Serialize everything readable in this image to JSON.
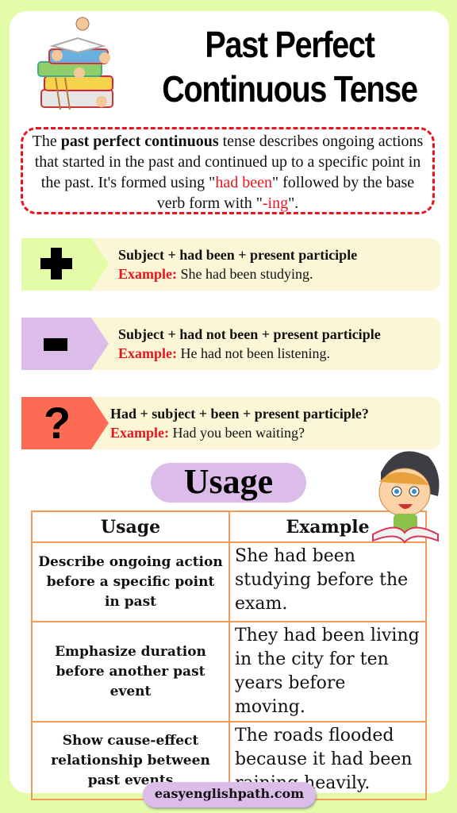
{
  "title": {
    "line1": "Past Perfect",
    "line2": "Continuous Tense"
  },
  "definition": {
    "pre": "The ",
    "bold": "past perfect continuous",
    "mid": " tense describes ongoing actions that started in the past and continued up to a specific point in the past. It's formed using \"",
    "red1": "had been",
    "mid2": "\" followed by the base verb form with \"",
    "red2": "-ing",
    "post": "\"."
  },
  "rules": [
    {
      "symbol": "+",
      "icon": "plus-icon",
      "color": "#e4fca8",
      "formula": "Subject + had been + present participle",
      "example_label": "Example:",
      "example": " She had been studying."
    },
    {
      "symbol": "−",
      "icon": "minus-icon",
      "color": "#dcbde9",
      "formula": "Subject + had not been + present participle",
      "example_label": "Example:",
      "example": " He had not been listening."
    },
    {
      "symbol": "?",
      "icon": "question-icon",
      "color": "#fe6b55",
      "formula": "Had + subject + been + present participle?",
      "example_label": "Example:",
      "example": " Had you been waiting?"
    }
  ],
  "usage_heading": "Usage",
  "table": {
    "headers": [
      "Usage",
      "Example"
    ],
    "rows": [
      {
        "usage": "Describe ongoing action before a specific point in past",
        "example": "She had been studying before the exam."
      },
      {
        "usage": "Emphasize duration before another past event",
        "example": "They had been living in the city for ten years before moving."
      },
      {
        "usage": "Show cause-effect relationship between past events",
        "example": "The roads flooded because it had been raining heavily."
      }
    ]
  },
  "footer": {
    "site": "easyenglishpath.com"
  },
  "colors": {
    "background": "#e4fca8",
    "accent_red": "#e8141e",
    "table_border": "#f49a59",
    "pill": "#dcbde9",
    "rule_body": "#fbf6d6"
  }
}
